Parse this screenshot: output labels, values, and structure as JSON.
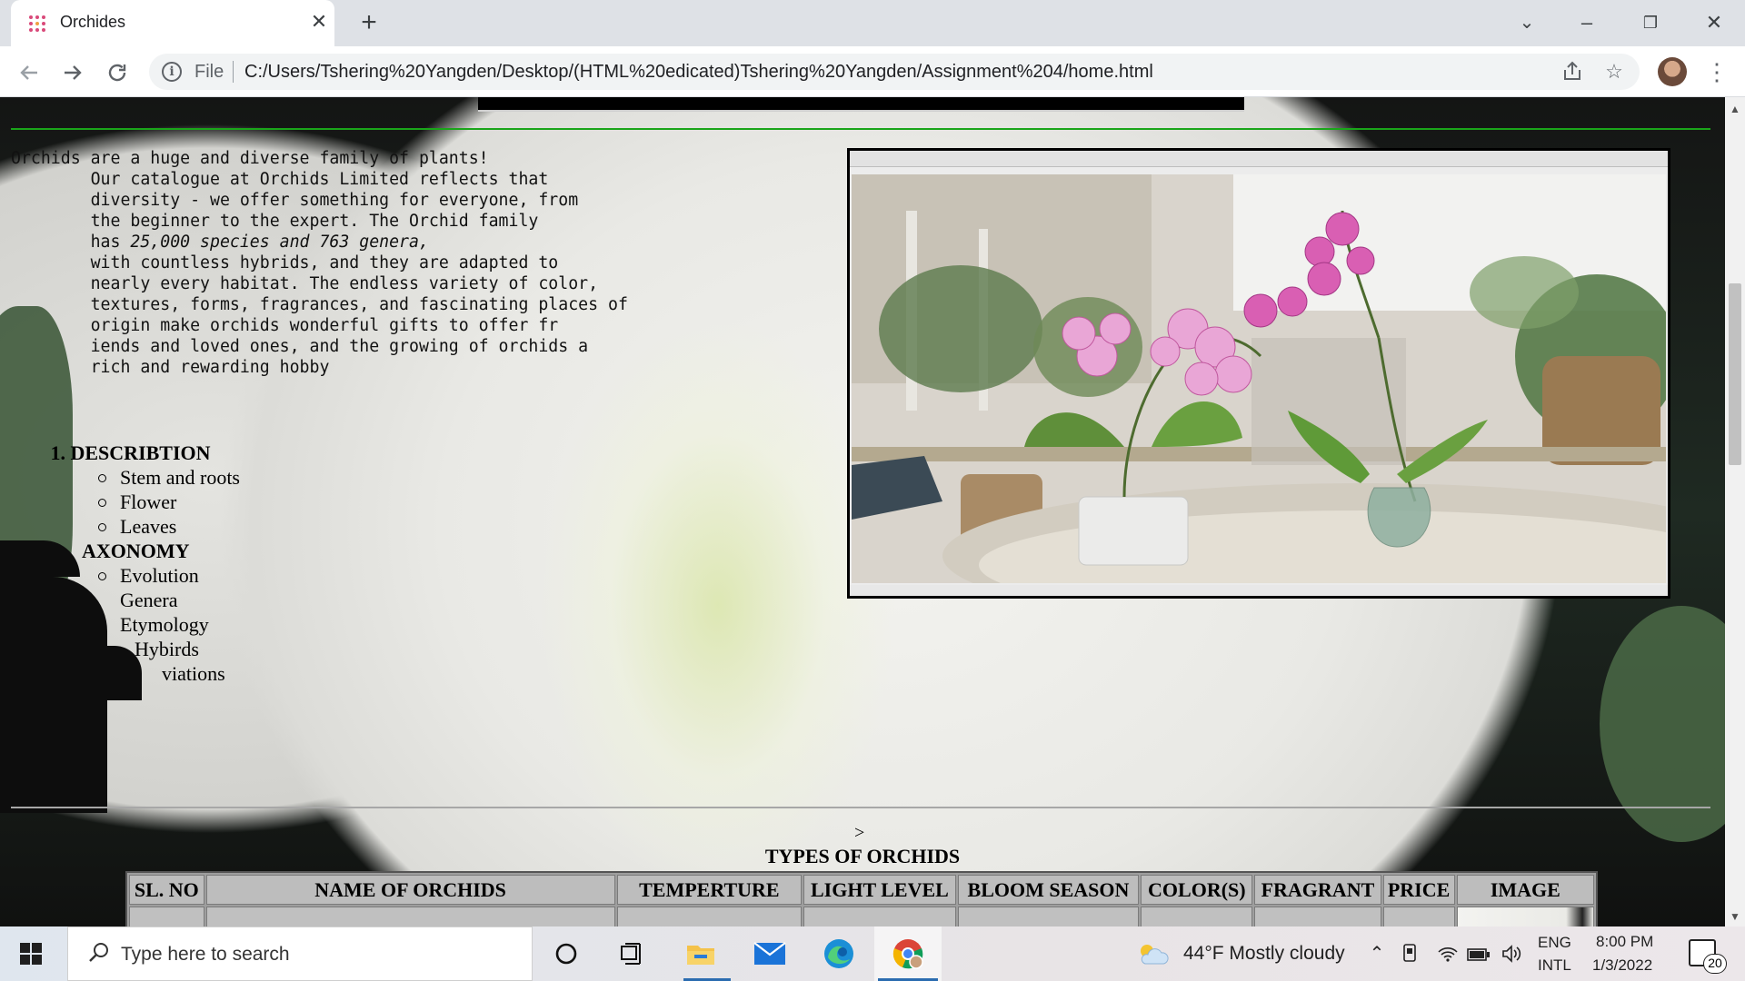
{
  "browser": {
    "tab_title": "Orchides",
    "new_tab_label": "+",
    "close_tab_label": "✕",
    "window_controls": {
      "minimize": "–",
      "restore": "❐",
      "close": "✕",
      "tab_search": "⌄"
    },
    "file_label": "File",
    "url": "C:/Users/Tshering%20Yangden/Desktop/(HTML%20edicated)Tshering%20Yangden/Assignment%204/home.html",
    "icons": [
      "back-arrow-icon",
      "forward-arrow-icon",
      "reload-icon",
      "info-icon",
      "share-icon",
      "star-icon",
      "profile-avatar",
      "menu-icon"
    ]
  },
  "page": {
    "intro_lines": [
      "Orchids are a huge and diverse family of plants!",
      "        Our catalogue at Orchids Limited reflects that",
      "        diversity - we offer something for everyone, from",
      "        the beginner to the expert. The Orchid family",
      "        with countless hybrids, and they are adapted to",
      "        nearly every habitat. The endless variety of color,",
      "        textures, forms, fragrances, and fascinating places of",
      "        origin make orchids wonderful gifts to offer fr",
      "        iends and loved ones, and the growing of orchids a",
      "        rich and rewarding hobby"
    ],
    "intro_species_prefix": "        has ",
    "intro_species_em": "25,000 species and 763 genera,",
    "outline": {
      "item1_number": "1.",
      "item1_title": "DESCRIBTION",
      "item1_subs": [
        "Stem and roots",
        "Flower",
        "Leaves"
      ],
      "item2_title": "AXONOMY",
      "item2_subs": [
        "Evolution",
        "Genera",
        "Etymology",
        "Hybirds",
        "viations"
      ]
    },
    "photo_alt": "Pink orchids in pots on a table",
    "stray_text": ">",
    "table_caption": "TYPES OF ORCHIDS",
    "table_headers": [
      "SL. NO",
      "NAME OF ORCHIDS",
      "TEMPERTURE",
      "LIGHT LEVEL",
      "BLOOM SEASON",
      "COLOR(S)",
      "FRAGRANT",
      "PRICE",
      "IMAGE"
    ]
  },
  "taskbar": {
    "search_placeholder": "Type here to search",
    "weather": "44°F  Mostly cloudy",
    "lang_top": "ENG",
    "lang_bottom": "INTL",
    "time": "8:00 PM",
    "date": "1/3/2022",
    "notification_count": "20",
    "pinned_apps": [
      "cortana-icon",
      "task-view-icon",
      "file-explorer-icon",
      "mail-icon",
      "edge-icon",
      "chrome-icon"
    ]
  },
  "colors": {
    "green_rule": "#1aa51a",
    "table_header_bg": "#bdbdbd",
    "taskbar_accent": "#2b6cb0"
  }
}
